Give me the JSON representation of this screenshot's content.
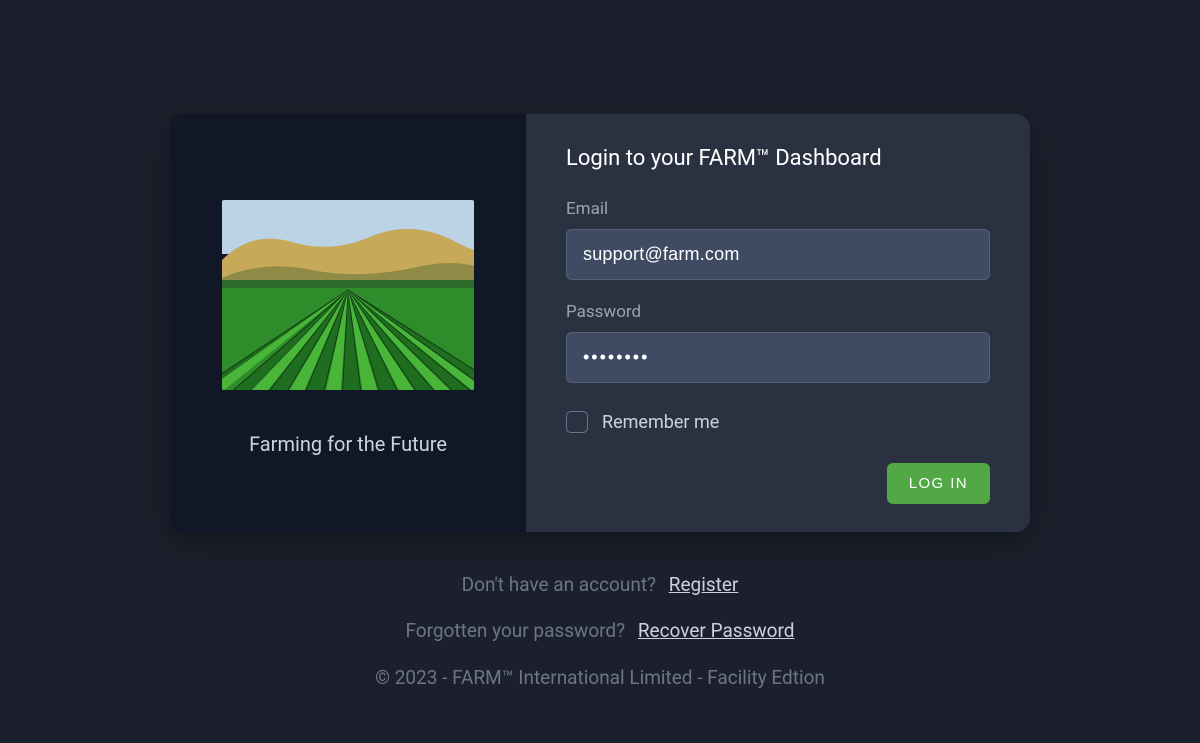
{
  "left": {
    "tagline": "Farming for the Future",
    "image_alt": "farm-field-image"
  },
  "form": {
    "title": "Login to your FARM™ Dashboard",
    "email_label": "Email",
    "email_value": "support@farm.com",
    "password_label": "Password",
    "password_value": "••••••••",
    "remember_label": "Remember me",
    "remember_checked": false,
    "submit_label": "LOG IN"
  },
  "footer": {
    "register_prompt": "Don't have an account?",
    "register_link": "Register",
    "recover_prompt": "Forgotten your password?",
    "recover_link": "Recover Password",
    "copyright": "© 2023 - FARM™ International Limited - Facility Edtion"
  }
}
